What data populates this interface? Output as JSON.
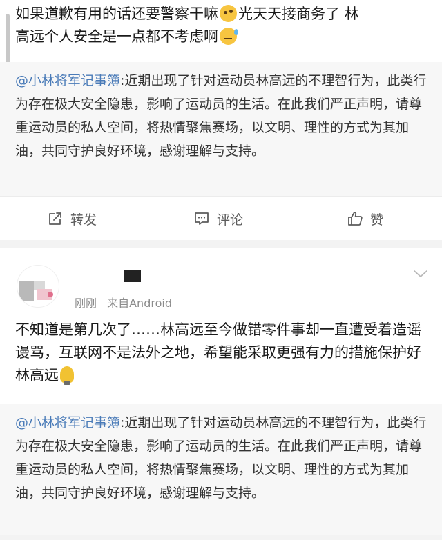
{
  "post1": {
    "line1": "如果道歉有用的话还要警察干嘛",
    "line1_tail": "光天天接商务了 林",
    "line2": "高远个人安全是一点都不考虑啊"
  },
  "quote": {
    "mention": "@小林将军记事簿",
    "text": ":近期出现了针对运动员林高远的不理智行为，此类行为存在极大安全隐患，影响了运动员的生活。在此我们严正声明，请尊重运动员的私人空间，将热情聚焦赛场，以文明、理性的方式为其加油，共同守护良好环境，感谢理解与支持。"
  },
  "actions": {
    "forward_label": "转发",
    "comment_label": "评论",
    "like_label": "赞"
  },
  "post2": {
    "time": "刚刚",
    "source": "来自Android",
    "text": "不知道是第几次了……林高远至今做错零件事却一直遭受着造谣谩骂，互联网不是法外之地，希望能采取更强有力的措施保护好林高远"
  },
  "icons": {
    "forward": "share-icon",
    "comment": "comment-icon",
    "like": "thumbs-up-icon",
    "menu": "chevron-down-icon"
  },
  "colors": {
    "mention": "#4a7bb8",
    "meta": "#8c8c8c",
    "quote_bg": "#f7f7f7"
  }
}
